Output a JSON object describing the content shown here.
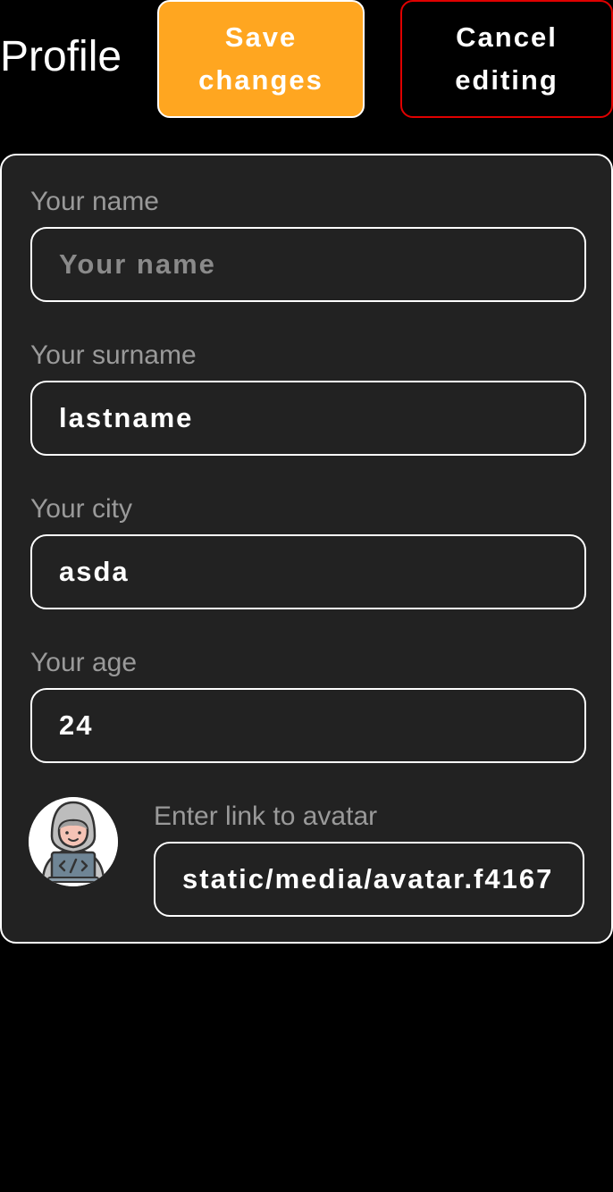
{
  "header": {
    "title": "Profile",
    "save_label": "Save changes",
    "cancel_label": "Cancel editing"
  },
  "form": {
    "name": {
      "label": "Your name",
      "placeholder": "Your name",
      "value": ""
    },
    "surname": {
      "label": "Your surname",
      "placeholder": "",
      "value": "lastname"
    },
    "city": {
      "label": "Your city",
      "placeholder": "",
      "value": "asda"
    },
    "age": {
      "label": "Your age",
      "placeholder": "",
      "value": "24"
    },
    "avatar": {
      "icon": "hooded-developer-avatar",
      "label": "Enter link to avatar",
      "value": "static/media/avatar.f4167"
    }
  },
  "colors": {
    "background": "#000000",
    "card": "#222222",
    "save_button": "#ffa620",
    "cancel_border": "#e00000",
    "label_text": "#9a9a9a"
  }
}
